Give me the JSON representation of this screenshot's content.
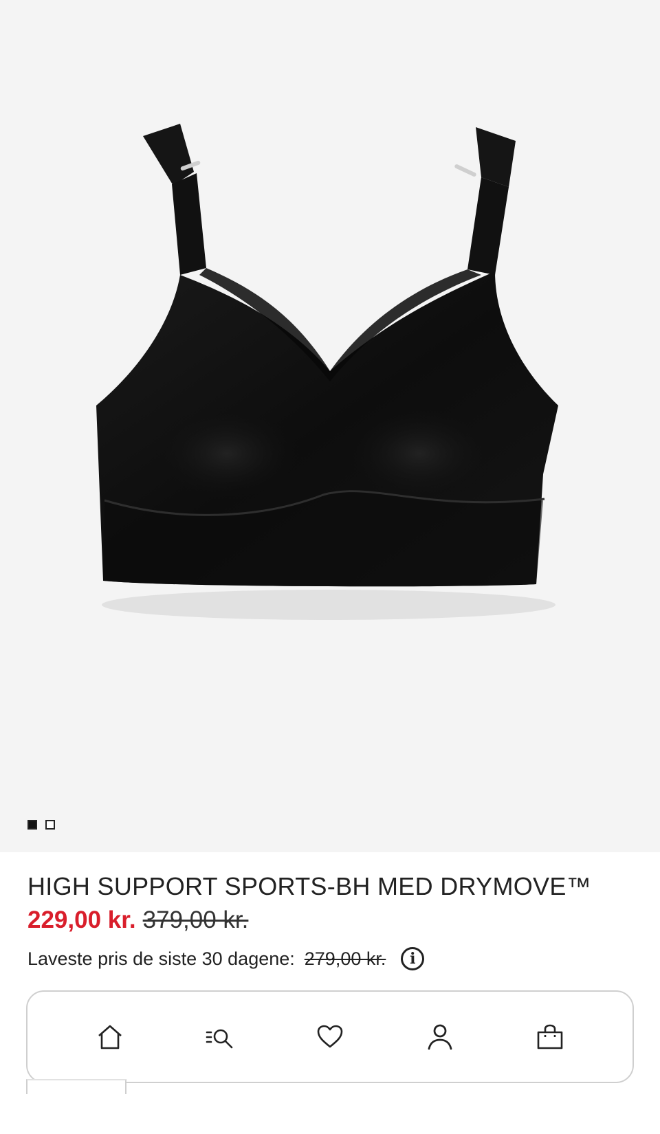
{
  "product": {
    "title": "HIGH SUPPORT SPORTS-BH MED DRYMOVE™",
    "price_sale": "229,00 kr.",
    "price_original": "379,00 kr.",
    "lowest_label": "Laveste pris de siste 30 dagene:",
    "lowest_price": "279,00 kr.",
    "info_glyph": "i"
  },
  "gallery": {
    "image_count": 2,
    "active_index": 0,
    "image_subject": "black high support sports bra"
  },
  "nav": {
    "items": [
      {
        "name": "home",
        "icon": "home-icon"
      },
      {
        "name": "search",
        "icon": "search-icon"
      },
      {
        "name": "favourites",
        "icon": "heart-icon"
      },
      {
        "name": "account",
        "icon": "user-icon"
      },
      {
        "name": "bag",
        "icon": "shopping-bag-icon"
      }
    ]
  },
  "colors": {
    "sale_price": "#d91e2b",
    "text": "#222222",
    "image_bg": "#f4f4f4",
    "nav_border": "#cfcfcf"
  }
}
